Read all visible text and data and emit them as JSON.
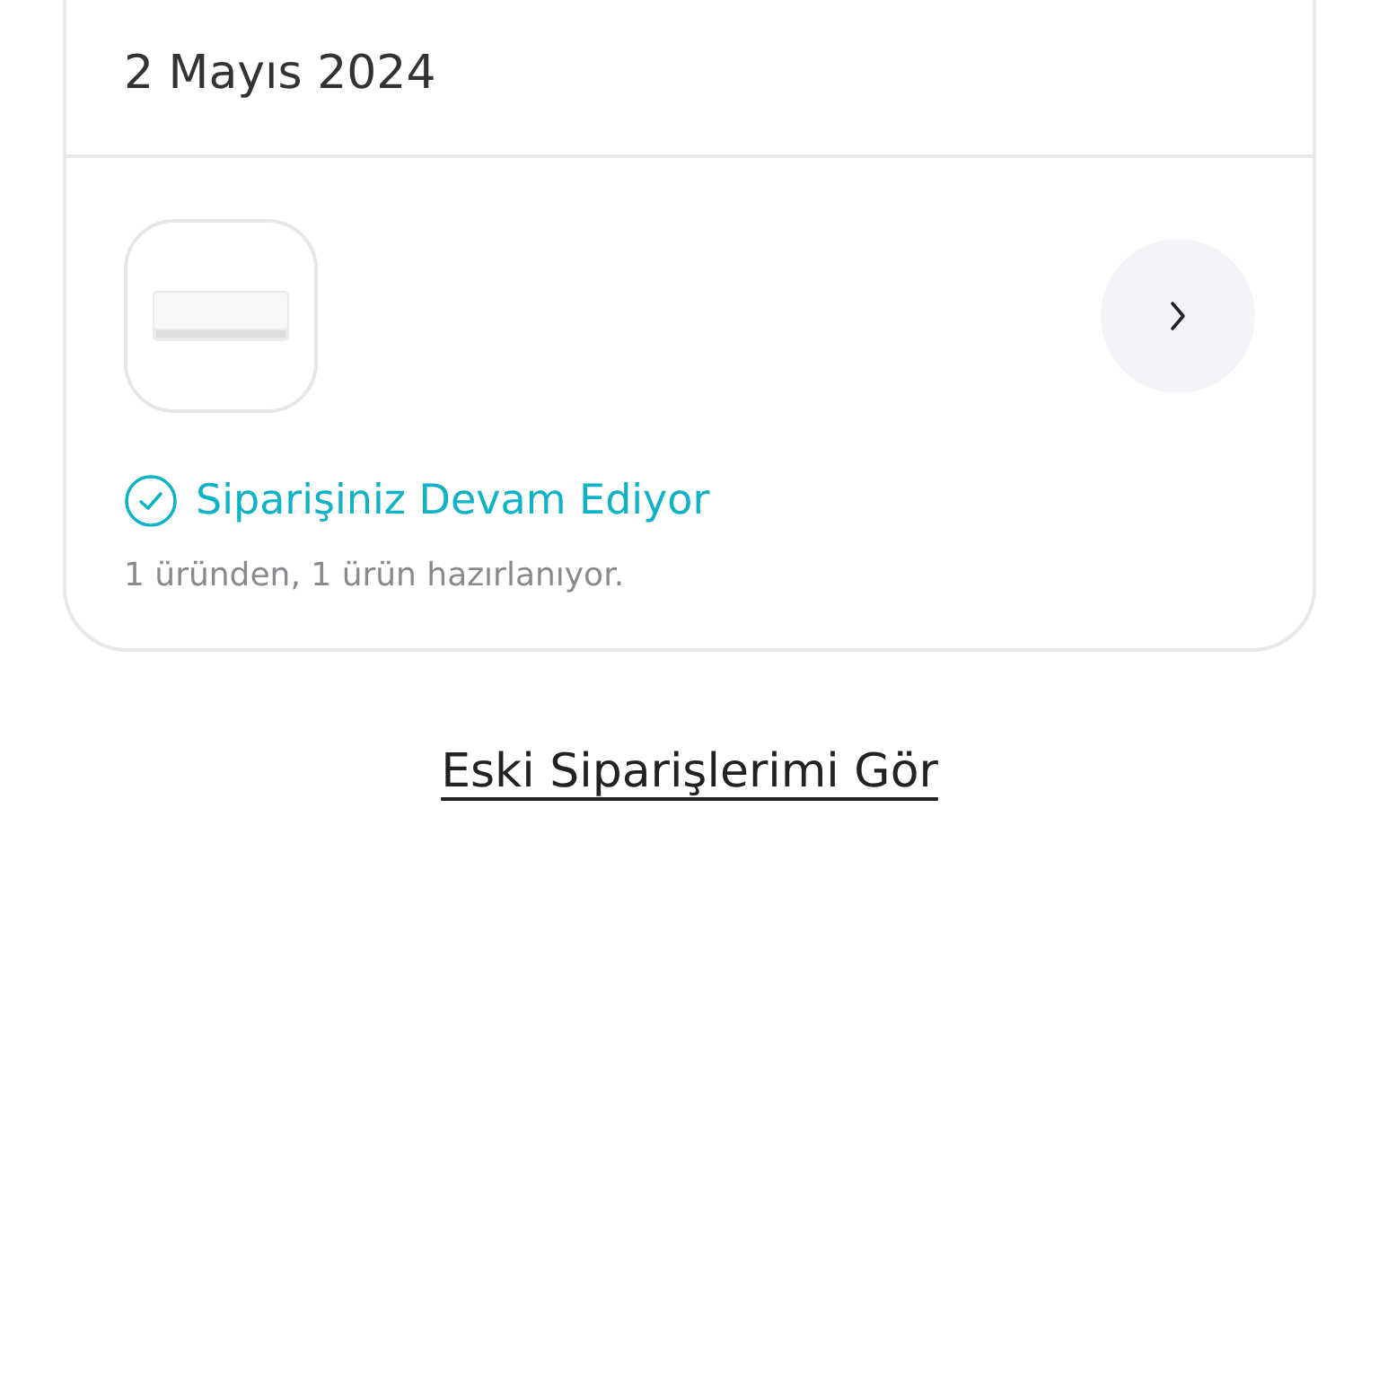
{
  "order": {
    "date": "2 Mayıs 2024",
    "status": {
      "label": "Siparişiniz Devam Ediyor",
      "detail": "1 üründen, 1 ürün hazırlanıyor."
    }
  },
  "old_orders_link": "Eski Siparişlerimi Gör"
}
